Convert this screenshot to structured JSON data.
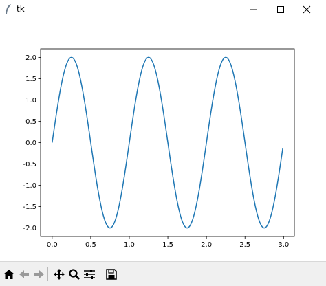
{
  "window": {
    "title": "tk",
    "controls": [
      "minimize-icon",
      "maximize-icon",
      "close-icon"
    ]
  },
  "toolbar": {
    "buttons": [
      {
        "name": "home-button",
        "icon": "home-icon"
      },
      {
        "name": "back-button",
        "icon": "arrow-left-icon"
      },
      {
        "name": "forward-button",
        "icon": "arrow-right-icon"
      },
      {
        "name": "pan-button",
        "icon": "move-icon"
      },
      {
        "name": "zoom-button",
        "icon": "magnifier-icon"
      },
      {
        "name": "configure-subplots-button",
        "icon": "sliders-icon"
      },
      {
        "name": "save-button",
        "icon": "floppy-disk-icon"
      }
    ]
  },
  "chart_data": {
    "type": "line",
    "title": "",
    "xlabel": "",
    "ylabel": "",
    "function": "y = 2*sin(2*pi*x)",
    "x_range": [
      0,
      2.99
    ],
    "xlim": [
      -0.15,
      3.14
    ],
    "ylim": [
      -2.2,
      2.2
    ],
    "xticks": [
      0.0,
      0.5,
      1.0,
      1.5,
      2.0,
      2.5,
      3.0
    ],
    "xtick_labels": [
      "0.0",
      "0.5",
      "1.0",
      "1.5",
      "2.0",
      "2.5",
      "3.0"
    ],
    "yticks": [
      -2.0,
      -1.5,
      -1.0,
      -0.5,
      0.0,
      0.5,
      1.0,
      1.5,
      2.0
    ],
    "ytick_labels": [
      "-2.0",
      "-1.5",
      "-1.0",
      "-0.5",
      "0.0",
      "0.5",
      "1.0",
      "1.5",
      "2.0"
    ],
    "grid": false,
    "color": "#1f77b4",
    "series": [
      {
        "x": [
          0.0,
          0.05,
          0.1,
          0.15,
          0.2,
          0.25,
          0.3,
          0.35,
          0.4,
          0.45,
          0.5,
          0.55,
          0.6,
          0.65,
          0.7,
          0.75,
          0.8,
          0.85,
          0.9,
          0.95,
          1.0,
          1.05,
          1.1,
          1.15,
          1.2,
          1.25,
          1.3,
          1.35,
          1.4,
          1.45,
          1.5,
          1.55,
          1.6,
          1.65,
          1.7,
          1.75,
          1.8,
          1.85,
          1.9,
          1.95,
          2.0,
          2.05,
          2.1,
          2.15,
          2.2,
          2.25,
          2.3,
          2.35,
          2.4,
          2.45,
          2.5,
          2.55,
          2.6,
          2.65,
          2.7,
          2.75,
          2.8,
          2.85,
          2.9,
          2.95,
          2.99
        ],
        "y": [
          0.0,
          0.618,
          1.176,
          1.618,
          1.902,
          2.0,
          1.902,
          1.618,
          1.176,
          0.618,
          0.0,
          -0.618,
          -1.176,
          -1.618,
          -1.902,
          -2.0,
          -1.902,
          -1.618,
          -1.176,
          -0.618,
          0.0,
          0.618,
          1.176,
          1.618,
          1.902,
          2.0,
          1.902,
          1.618,
          1.176,
          0.618,
          0.0,
          -0.618,
          -1.176,
          -1.618,
          -1.902,
          -2.0,
          -1.902,
          -1.618,
          -1.176,
          -0.618,
          0.0,
          0.618,
          1.176,
          1.618,
          1.902,
          2.0,
          1.902,
          1.618,
          1.176,
          0.618,
          0.0,
          -0.618,
          -1.176,
          -1.618,
          -1.902,
          -2.0,
          -1.902,
          -1.618,
          -1.176,
          -0.618,
          -0.126
        ]
      }
    ]
  }
}
